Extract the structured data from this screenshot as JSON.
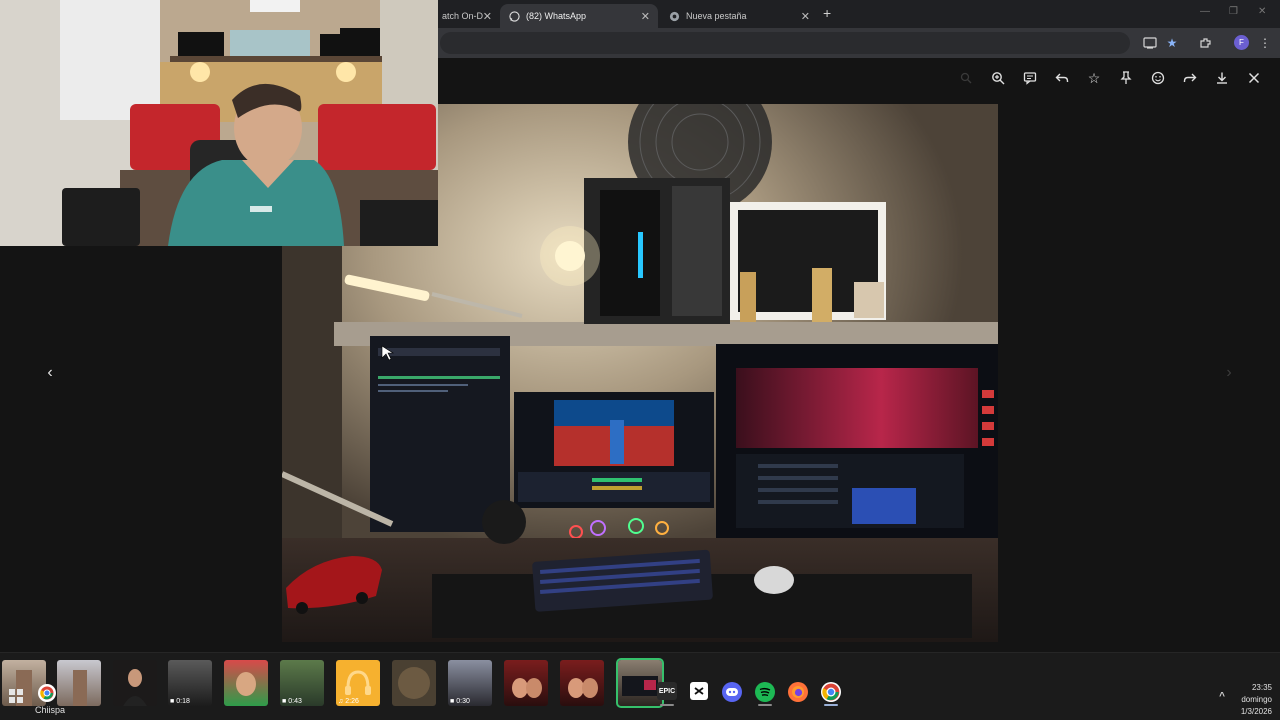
{
  "browser": {
    "tabs": [
      {
        "label": "atch On-D",
        "active": false
      },
      {
        "label": "(82) WhatsApp",
        "active": true
      },
      {
        "label": "Nueva pestaña",
        "active": false
      }
    ],
    "new_tab": "+",
    "profile_initial": "F"
  },
  "viewer": {
    "toolbar_icons": [
      "search-icon",
      "zoom-in-icon",
      "comment-icon",
      "reply-icon",
      "star-icon",
      "pin-icon",
      "emoji-icon",
      "forward-icon",
      "download-icon",
      "close-icon"
    ],
    "prev_glyph": "‹",
    "next_glyph": "›"
  },
  "media_strip": {
    "thumbnails": [
      {
        "kind": "photo",
        "duration": ""
      },
      {
        "kind": "photo",
        "duration": ""
      },
      {
        "kind": "photo",
        "duration": ""
      },
      {
        "kind": "video",
        "duration": "0:18"
      },
      {
        "kind": "photo",
        "duration": ""
      },
      {
        "kind": "video",
        "duration": "0:43"
      },
      {
        "kind": "audio",
        "duration": "2:26"
      },
      {
        "kind": "photo",
        "duration": ""
      },
      {
        "kind": "video",
        "duration": "0:30"
      },
      {
        "kind": "photo",
        "duration": ""
      },
      {
        "kind": "photo",
        "duration": ""
      },
      {
        "kind": "photo",
        "duration": "",
        "selected": true
      }
    ]
  },
  "taskbar": {
    "label": "Chiispa",
    "time": "23:35",
    "day": "domingo",
    "date": "1/3/2026",
    "epic_label": "EPIC"
  },
  "colors": {
    "selected_outline": "#36c06b",
    "whatsapp_green": "#25d366",
    "spotify_green": "#1db954",
    "discord_blue": "#5865f2"
  }
}
